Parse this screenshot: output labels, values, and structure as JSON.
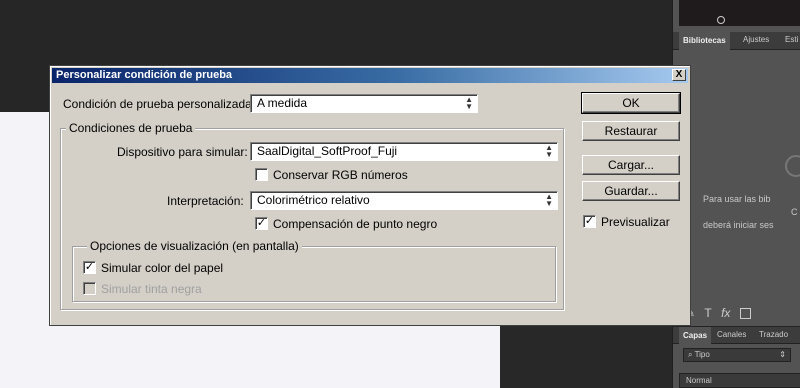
{
  "background": {
    "panel": {
      "tabs_top": [
        "Bibliotecas",
        "Ajustes",
        "Esti"
      ],
      "library_message": [
        "Para usar las bib",
        "C",
        "deberá iniciar ses"
      ],
      "tools": [
        "T",
        "fx"
      ],
      "tabs_bottom": [
        "Capas",
        "Canales",
        "Trazado"
      ],
      "kind_filter": "Tipo",
      "blend_mode": "Normal"
    }
  },
  "dialog": {
    "title": "Personalizar condición de prueba",
    "close_label": "X",
    "custom_condition_label": "Condición de prueba personalizada:",
    "custom_condition_value": "A medida",
    "proof_conditions": {
      "title": "Condiciones de prueba",
      "device_label": "Dispositivo para simular:",
      "device_value": "SaalDigital_SoftProof_Fuji",
      "preserve_rgb": {
        "label": "Conservar RGB números",
        "checked": false
      },
      "intent_label": "Interpretación:",
      "intent_value": "Colorimétrico relativo",
      "black_point": {
        "label": "Compensación de punto negro",
        "checked": true
      }
    },
    "display_options": {
      "title": "Opciones de visualización (en pantalla)",
      "simulate_paper": {
        "label": "Simular color del papel",
        "checked": true
      },
      "simulate_black_ink": {
        "label": "Simular tinta negra",
        "checked": false,
        "disabled": true
      }
    },
    "buttons": {
      "ok": "OK",
      "reset": "Restaurar",
      "load": "Cargar...",
      "save": "Guardar..."
    },
    "preview": {
      "label": "Previsualizar",
      "checked": true
    }
  },
  "icons": {
    "checkmark": "✓",
    "updown": "▲▼"
  }
}
